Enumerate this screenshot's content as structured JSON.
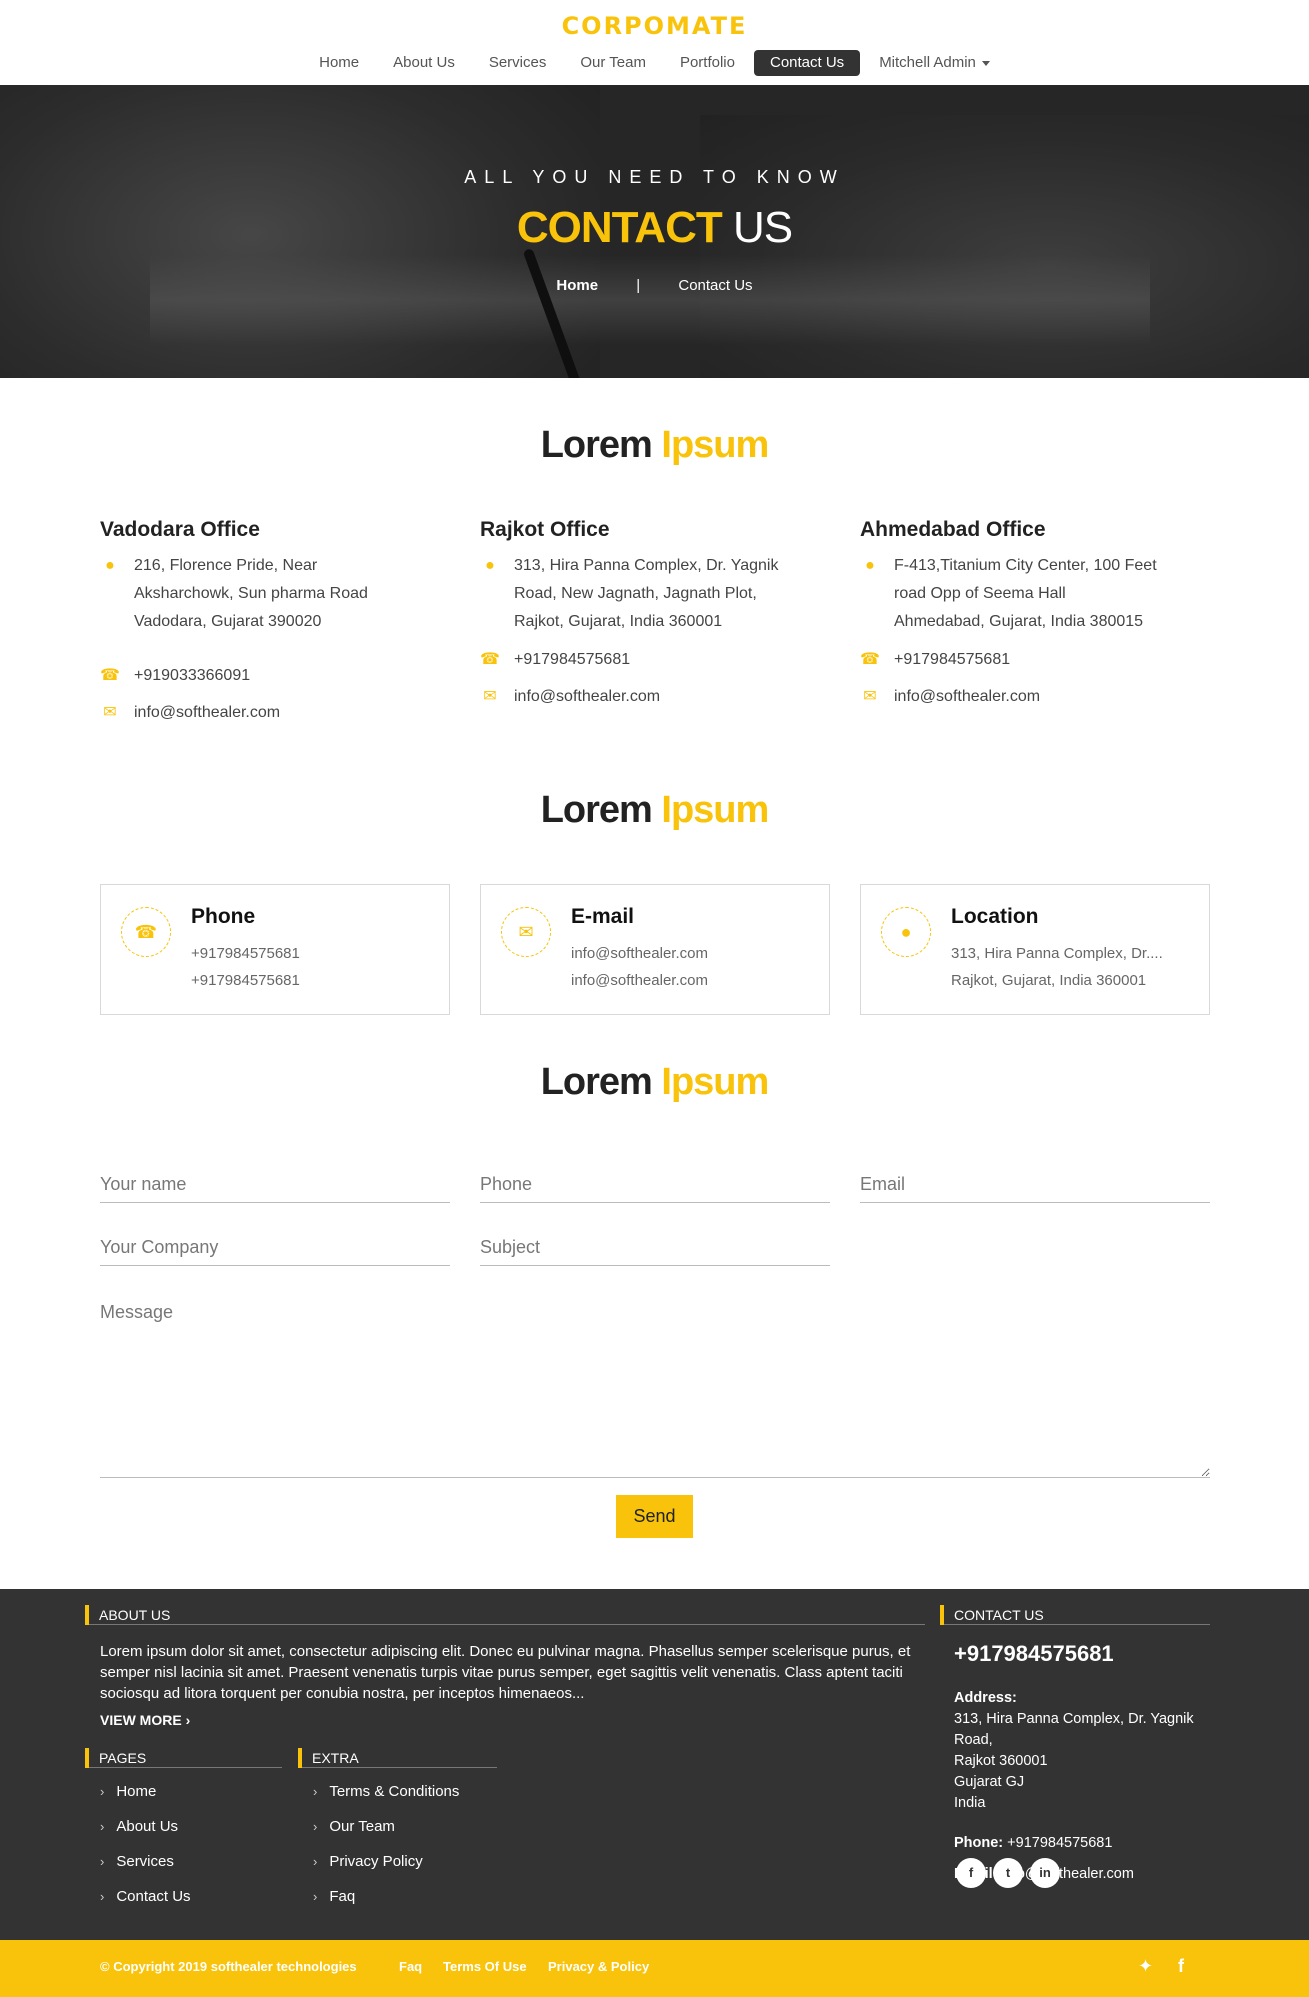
{
  "header": {
    "logo": "CORPOMATE",
    "nav": [
      "Home",
      "About Us",
      "Services",
      "Our Team",
      "Portfolio",
      "Contact Us",
      "Mitchell Admin"
    ],
    "active": "Contact Us"
  },
  "hero": {
    "kicker": "ALL YOU NEED TO KNOW",
    "title_accent": "CONTACT",
    "title_rest": " US",
    "breadcrumb_home": "Home",
    "breadcrumb_sep": "|",
    "breadcrumb_current": "Contact Us"
  },
  "sections": {
    "t1": {
      "a": "Lorem ",
      "b": "Ipsum"
    },
    "t2": {
      "a": "Lorem ",
      "b": "Ipsum"
    },
    "t3": {
      "a": "Lorem ",
      "b": "Ipsum"
    }
  },
  "offices": [
    {
      "name": "Vadodara Office",
      "addr1": "216, Florence Pride, Near",
      "addr2": "Aksharchowk, Sun pharma Road",
      "addr3": "Vadodara, Gujarat 390020",
      "phone": "+919033366091",
      "email": "info@softhealer.com"
    },
    {
      "name": "Rajkot Office",
      "addr1": "313, Hira Panna Complex, Dr. Yagnik",
      "addr2": "Road, New Jagnath, Jagnath Plot,",
      "addr3": "Rajkot, Gujarat, India 360001",
      "phone": "+917984575681",
      "email": "info@softhealer.com"
    },
    {
      "name": "Ahmedabad Office",
      "addr1": "F-413,Titanium City Center, 100 Feet",
      "addr2": "road Opp of Seema Hall",
      "addr3": "Ahmedabad, Gujarat, India 380015",
      "phone": "+917984575681",
      "email": "info@softhealer.com"
    }
  ],
  "boxes": [
    {
      "title": "Phone",
      "l1": "+917984575681",
      "l2": "+917984575681",
      "icon": "phone-icon"
    },
    {
      "title": "E-mail",
      "l1": "info@softhealer.com",
      "l2": "info@softhealer.com",
      "icon": "envelope-icon"
    },
    {
      "title": "Location",
      "l1": "313, Hira Panna Complex, Dr....",
      "l2": "Rajkot, Gujarat, India 360001",
      "icon": "map-marker-icon"
    }
  ],
  "form": {
    "name_ph": "Your name",
    "phone_ph": "Phone",
    "email_ph": "Email",
    "company_ph": "Your Company",
    "subject_ph": "Subject",
    "message_ph": "Message",
    "send": "Send"
  },
  "footer": {
    "about_head": "ABOUT US",
    "about_text": "Lorem ipsum dolor sit amet, consectetur adipiscing elit. Donec eu pulvinar magna. Phasellus semper scelerisque purus, et semper nisl lacinia sit amet. Praesent venenatis turpis vitae purus semper, eget sagittis velit venenatis. Class aptent taciti sociosqu ad litora torquent per conubia nostra, per inceptos himenaeos...",
    "view_more": "VIEW MORE",
    "pages_head": "PAGES",
    "pages": [
      "Home",
      "About Us",
      "Services",
      "Contact Us"
    ],
    "extra_head": "EXTRA",
    "extra": [
      "Terms & Conditions",
      "Our Team",
      "Privacy Policy",
      "Faq"
    ],
    "contact_head": "CONTACT US",
    "contact_phone": "+917984575681",
    "address_label": "Address:",
    "address_lines": [
      "313, Hira Panna Complex, Dr. Yagnik",
      "Road,",
      "Rajkot 360001",
      "Gujarat GJ",
      "India"
    ],
    "phone_label": "Phone:",
    "phone_value": " +917984575681",
    "email_label": "Email:",
    "email_value": " info@softhealer.com",
    "social": [
      "f",
      "t",
      "in"
    ]
  },
  "bottom": {
    "copyright": "© Copyright 2019 softhealer technologies",
    "links": [
      "Faq",
      "Terms Of Use",
      "Privacy & Policy"
    ]
  },
  "colors": {
    "accent": "#f8c30a",
    "dark": "#333333"
  }
}
